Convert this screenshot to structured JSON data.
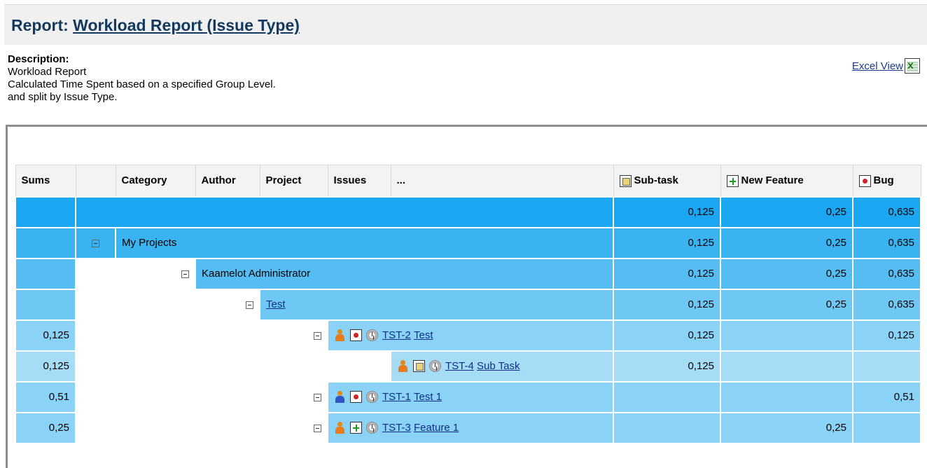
{
  "report": {
    "prefix": "Report:",
    "title": "Workload Report (Issue Type)"
  },
  "description": {
    "heading": "Description:",
    "lines": [
      "Workload Report",
      "Calculated Time Spent based on a specified Group Level.",
      "and split by Issue Type."
    ]
  },
  "excel_link": "Excel View",
  "headers": {
    "sums": "Sums",
    "category": "Category",
    "author": "Author",
    "project": "Project",
    "issues": "Issues",
    "more": "...",
    "subtask": "Sub-task",
    "newfeature": "New Feature",
    "bug": "Bug"
  },
  "icons": {
    "subtask": "subtask-icon",
    "newfeature": "new-feature-icon",
    "bug": "bug-icon",
    "user": "user-icon",
    "clock": "clock-icon",
    "excel": "excel-icon",
    "collapse": "collapse-toggle-icon"
  },
  "rows": {
    "total": {
      "sums": "",
      "subtask": "0,125",
      "newfeature": "0,25",
      "bug": "0,635"
    },
    "category": {
      "label": "My Projects",
      "subtask": "0,125",
      "newfeature": "0,25",
      "bug": "0,635"
    },
    "author": {
      "label": "Kaamelot Administrator",
      "subtask": "0,125",
      "newfeature": "0,25",
      "bug": "0,635"
    },
    "project": {
      "label": "Test",
      "subtask": "0,125",
      "newfeature": "0,25",
      "bug": "0,635"
    },
    "issues": [
      {
        "sums": "0,125",
        "key": "TST-2",
        "summary": "Test",
        "subtask": "0,125",
        "newfeature": "",
        "bug": "0,125"
      },
      {
        "sums": "0,125",
        "key": "TST-4",
        "summary": "Sub Task",
        "subtask": "0,125",
        "newfeature": "",
        "bug": ""
      },
      {
        "sums": "0,51",
        "key": "TST-1",
        "summary": "Test 1",
        "subtask": "",
        "newfeature": "",
        "bug": "0,51"
      },
      {
        "sums": "0,25",
        "key": "TST-3",
        "summary": "Feature 1",
        "subtask": "",
        "newfeature": "0,25",
        "bug": ""
      }
    ]
  },
  "colors": {
    "title": "#14395e",
    "level0": "#1aa6f0",
    "level1": "#3ab3f0",
    "level2": "#55bdf2",
    "level3": "#6fc8f4",
    "level4": "#8ad3f6",
    "level5": "#a7dcf6"
  }
}
